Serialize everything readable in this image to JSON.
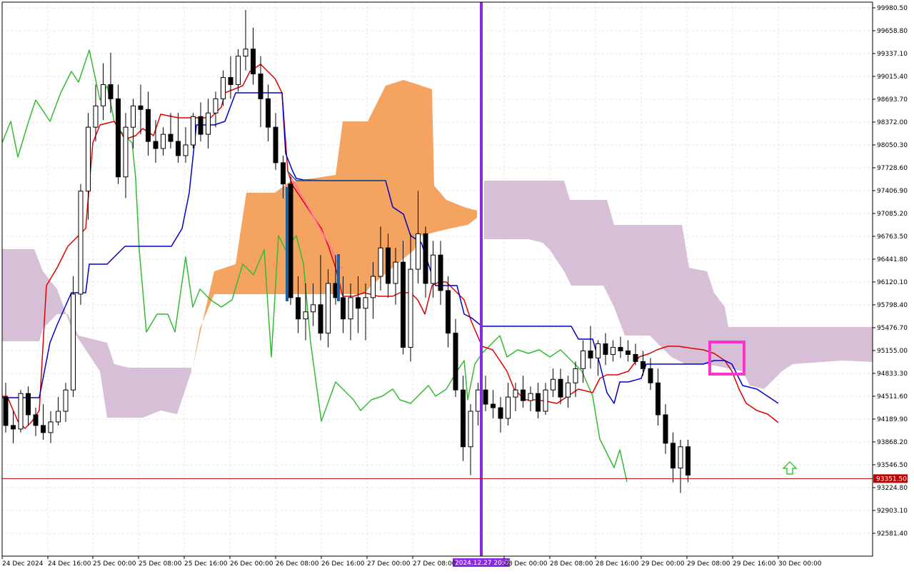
{
  "chart_data": {
    "type": "candlestick",
    "title": "",
    "price_axis": {
      "ylim": [
        92400,
        100100
      ],
      "ticks": [
        "99980.50",
        "99658.80",
        "99337.10",
        "99015.40",
        "98693.70",
        "98372.00",
        "98050.30",
        "97728.60",
        "97406.90",
        "97085.20",
        "96763.50",
        "96441.80",
        "96120.10",
        "95798.40",
        "95476.70",
        "95155.00",
        "94833.30",
        "94511.60",
        "94189.90",
        "93868.20",
        "93546.50",
        "93224.80",
        "92903.10",
        "92581.40"
      ]
    },
    "time_axis": {
      "ticks": [
        "24 Dec 2024",
        "24 Dec 16:00",
        "25 Dec 00:00",
        "25 Dec 08:00",
        "25 Dec 16:00",
        "26 Dec 00:00",
        "26 Dec 08:00",
        "26 Dec 16:00",
        "27 Dec 00:00",
        "27 Dec 08:00",
        "28 Dec 00:00",
        "28 Dec 08:00",
        "28 Dec 16:00",
        "29 Dec 00:00",
        "29 Dec 08:00",
        "29 Dec 16:00",
        "30 Dec 00:00"
      ],
      "crosshair_label": "2024.12.27 20:00"
    },
    "current_price": "93351.50",
    "grid": true,
    "indicators": [
      "Tenkan-sen",
      "Kijun-sen",
      "Chikou Span",
      "Senkou Span A",
      "Senkou Span B"
    ],
    "colors": {
      "bull_candle": "#ffffff",
      "bear_candle": "#000000",
      "tenkan": "#e00000",
      "kijun": "#0000cc",
      "chikou": "#33bb33",
      "kumo_bull": "#f4a460",
      "kumo_bear": "#d8bfd8",
      "crosshair": "#8a2be2",
      "price_line": "#c00000",
      "highlight_box": "#ff33cc",
      "arrow": "#33cc33"
    },
    "candles": [
      [
        94500,
        94700,
        94000,
        94100
      ],
      [
        94100,
        94300,
        93850,
        94050
      ],
      [
        94050,
        94600,
        94000,
        94550
      ],
      [
        94550,
        94650,
        94100,
        94250
      ],
      [
        94250,
        94350,
        93950,
        94100
      ],
      [
        94100,
        94400,
        93900,
        94000
      ],
      [
        94000,
        94300,
        93850,
        94150
      ],
      [
        94150,
        94500,
        94100,
        94300
      ],
      [
        94300,
        94700,
        94150,
        94600
      ],
      [
        94600,
        96200,
        94500,
        95950
      ],
      [
        95950,
        97500,
        95800,
        97400
      ],
      [
        97400,
        98500,
        97000,
        98300
      ],
      [
        98300,
        98900,
        98100,
        98600
      ],
      [
        98600,
        99200,
        98400,
        98900
      ],
      [
        98900,
        99350,
        98500,
        98700
      ],
      [
        98700,
        98900,
        97500,
        97600
      ],
      [
        97600,
        98500,
        97300,
        98300
      ],
      [
        98300,
        98700,
        98000,
        98600
      ],
      [
        98600,
        98900,
        98200,
        98550
      ],
      [
        98550,
        98800,
        97900,
        98100
      ],
      [
        98100,
        98400,
        97800,
        98000
      ],
      [
        98000,
        98300,
        97900,
        98200
      ],
      [
        98200,
        98500,
        98000,
        98100
      ],
      [
        98100,
        98500,
        97800,
        97900
      ],
      [
        97900,
        98300,
        97800,
        98050
      ],
      [
        98050,
        98500,
        98000,
        98450
      ],
      [
        98450,
        98650,
        98100,
        98200
      ],
      [
        98200,
        98700,
        98000,
        98500
      ],
      [
        98500,
        98800,
        98300,
        98700
      ],
      [
        98700,
        99100,
        98600,
        99000
      ],
      [
        99000,
        99300,
        98700,
        98900
      ],
      [
        98900,
        99400,
        98800,
        99300
      ],
      [
        99300,
        99950,
        99100,
        99400
      ],
      [
        99400,
        99700,
        98900,
        99050
      ],
      [
        99050,
        99300,
        98300,
        98700
      ],
      [
        98700,
        98900,
        98100,
        98300
      ],
      [
        98300,
        98500,
        97700,
        97800
      ],
      [
        97800,
        97900,
        97300,
        97500
      ],
      [
        97500,
        97600,
        95800,
        95900
      ],
      [
        95900,
        96200,
        95400,
        95600
      ],
      [
        95600,
        96100,
        95300,
        95700
      ],
      [
        95700,
        96100,
        95500,
        95800
      ],
      [
        95800,
        96500,
        95300,
        95400
      ],
      [
        95400,
        96300,
        95200,
        96100
      ],
      [
        96100,
        96500,
        95800,
        95900
      ],
      [
        95900,
        96200,
        95400,
        95600
      ],
      [
        95600,
        96100,
        95300,
        95900
      ],
      [
        95900,
        96200,
        95400,
        95750
      ],
      [
        95750,
        96100,
        95300,
        95900
      ],
      [
        95900,
        96400,
        95600,
        96200
      ],
      [
        96200,
        96900,
        96000,
        96600
      ],
      [
        96600,
        96800,
        95900,
        96100
      ],
      [
        96100,
        96600,
        95800,
        96400
      ],
      [
        96400,
        96700,
        95100,
        95200
      ],
      [
        95200,
        96800,
        95000,
        96300
      ],
      [
        96300,
        97400,
        96100,
        96800
      ],
      [
        96800,
        96900,
        95900,
        96100
      ],
      [
        96100,
        96700,
        95900,
        96500
      ],
      [
        96500,
        96700,
        95800,
        96000
      ],
      [
        96000,
        96200,
        95200,
        95400
      ],
      [
        95400,
        95600,
        94500,
        94600
      ],
      [
        94600,
        94800,
        93600,
        93800
      ],
      [
        93800,
        94400,
        93400,
        94300
      ],
      [
        94300,
        94700,
        94100,
        94600
      ],
      [
        94600,
        94800,
        94300,
        94400
      ],
      [
        94400,
        94600,
        94200,
        94350
      ],
      [
        94350,
        94500,
        94000,
        94200
      ],
      [
        94200,
        94700,
        94100,
        94500
      ],
      [
        94500,
        94700,
        94300,
        94600
      ],
      [
        94600,
        94800,
        94350,
        94450
      ],
      [
        94450,
        94650,
        94300,
        94550
      ],
      [
        94550,
        94700,
        94200,
        94300
      ],
      [
        94300,
        94700,
        94250,
        94600
      ],
      [
        94600,
        94900,
        94500,
        94750
      ],
      [
        94750,
        94900,
        94400,
        94500
      ],
      [
        94500,
        94800,
        94350,
        94700
      ],
      [
        94700,
        95000,
        94500,
        94900
      ],
      [
        94900,
        95300,
        94700,
        95150
      ],
      [
        95150,
        95500,
        94900,
        95050
      ],
      [
        95050,
        95300,
        94800,
        95250
      ],
      [
        95250,
        95400,
        94950,
        95100
      ],
      [
        95100,
        95300,
        95000,
        95200
      ],
      [
        95200,
        95350,
        95050,
        95150
      ],
      [
        95150,
        95300,
        95000,
        95100
      ],
      [
        95100,
        95250,
        94950,
        95000
      ],
      [
        95000,
        95150,
        94800,
        94900
      ],
      [
        94900,
        95050,
        94600,
        94700
      ],
      [
        94700,
        94900,
        94100,
        94250
      ],
      [
        94250,
        94400,
        93700,
        93850
      ],
      [
        93850,
        94000,
        93300,
        93500
      ],
      [
        93500,
        93900,
        93150,
        93800
      ],
      [
        93800,
        93900,
        93300,
        93400
      ]
    ]
  }
}
